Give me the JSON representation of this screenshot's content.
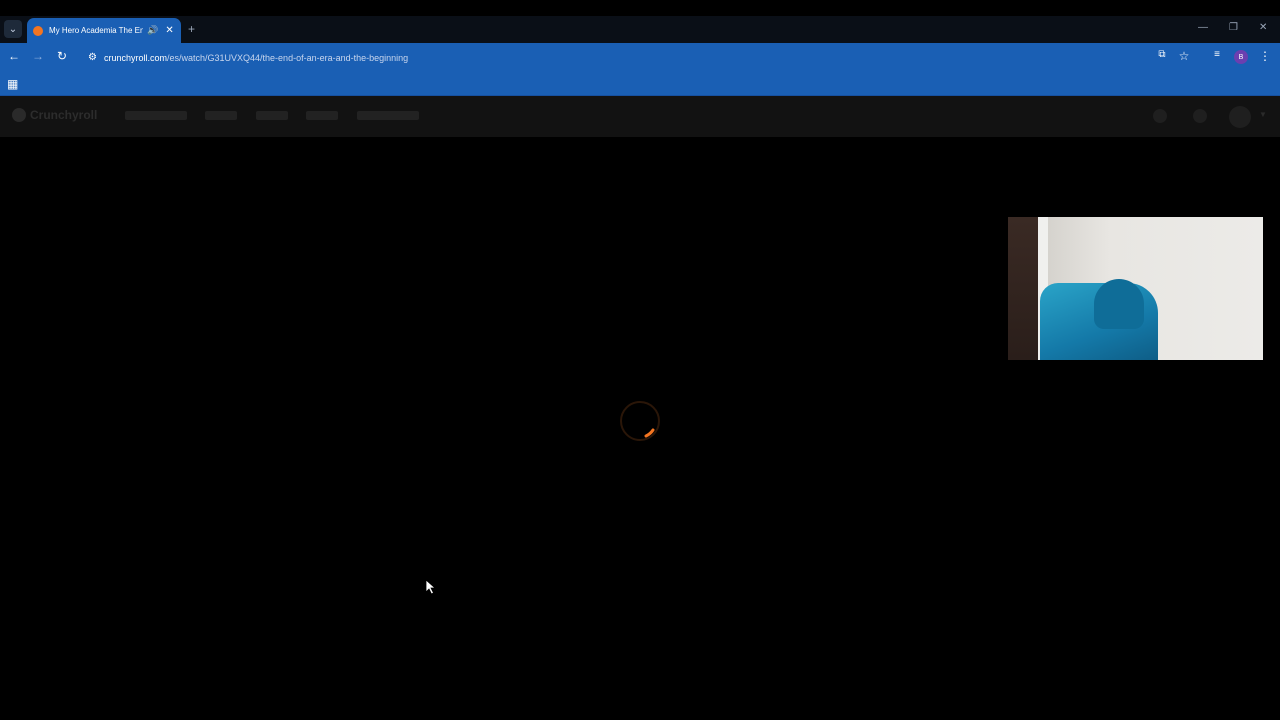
{
  "browser": {
    "tab": {
      "title": "My Hero Academia The End of an Era and the Beginning",
      "audio_icon": "speaker-icon",
      "close_icon": "close-icon"
    },
    "new_tab_label": "+",
    "window_controls": [
      "—",
      "❐",
      "✕"
    ],
    "url": {
      "domain": "crunchyroll.com",
      "path": "/es/watch/G31UVXQ44/the-end-of-an-era-and-the-beginning"
    },
    "profile_initial": "B"
  },
  "site": {
    "logo_text": "Crunchyroll"
  },
  "player": {
    "state": "loading",
    "spinner_color": "#f47521"
  },
  "colors": {
    "accent": "#1a5fb4",
    "brand": "#f47521"
  }
}
